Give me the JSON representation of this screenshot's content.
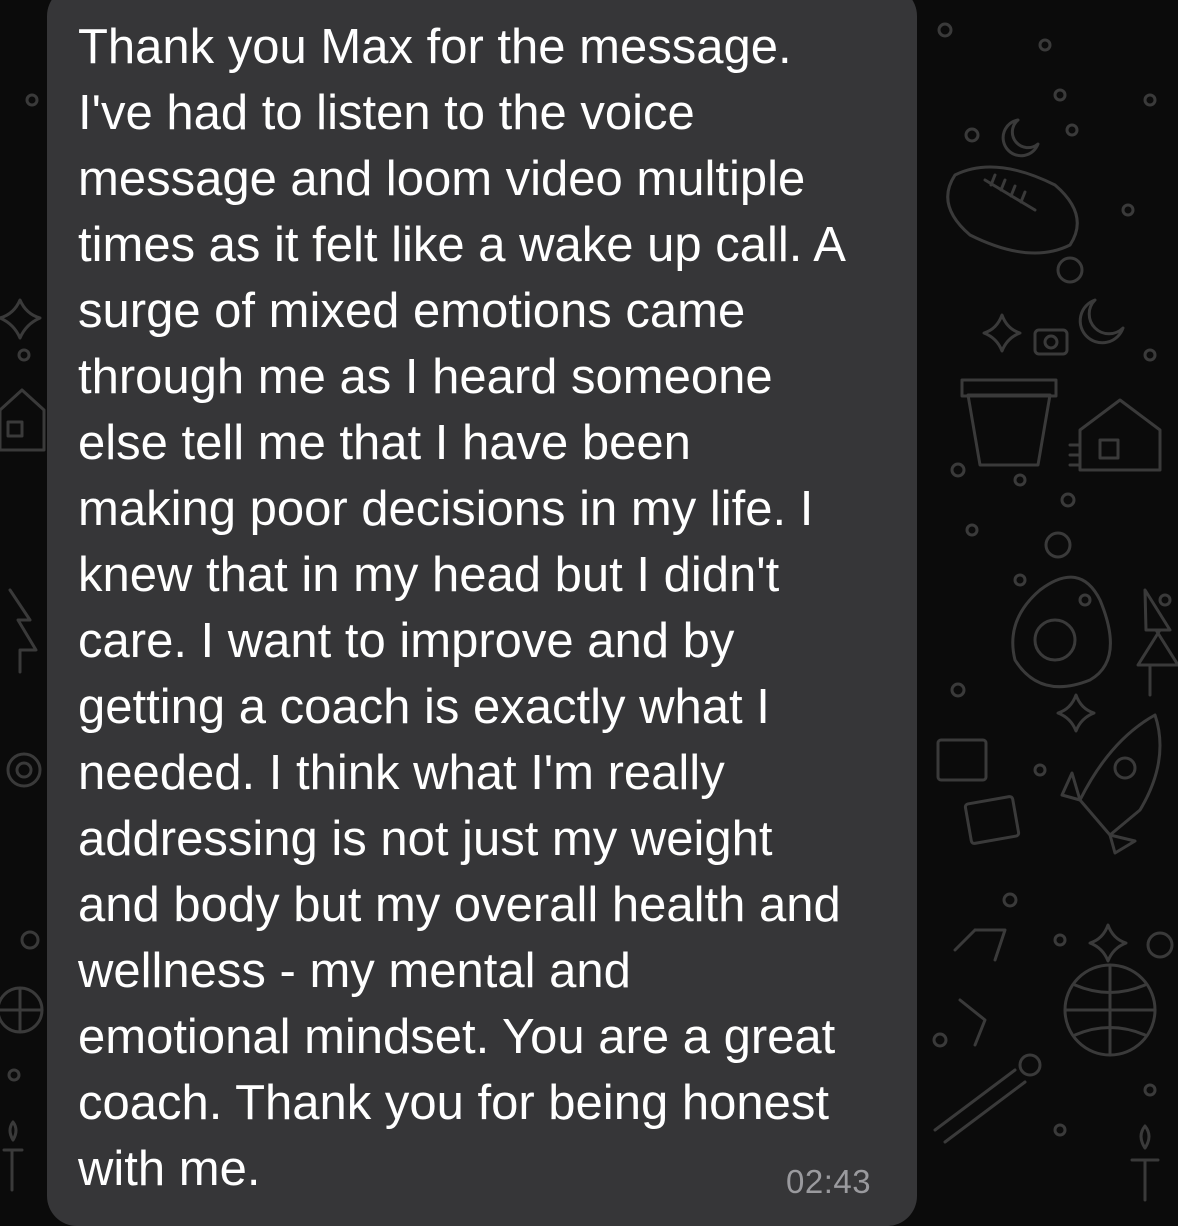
{
  "message": {
    "text": "Thank you Max for the message.\nI've had to listen to the voice\nmessage and loom video multiple\ntimes as it felt like a wake up call. A\nsurge of mixed emotions came\nthrough me as I heard someone\nelse tell me that I have been\nmaking poor decisions in my life. I\nknew that in my head but I didn't\ncare. I want to improve and by\ngetting a coach is exactly what I\nneeded. I think what I'm really\naddressing is not just my weight\nand body but my overall health and\nwellness - my mental and\nemotional mindset. You are a great\ncoach. Thank you for being honest\nwith me.",
    "time": "02:43"
  },
  "colors": {
    "background": "#0b0b0b",
    "bubble": "#363638",
    "text": "#ffffff",
    "timestamp": "#9a9a9e",
    "doodle": "#3a3a3a"
  },
  "background_icons": [
    "rocket-icon",
    "house-icon",
    "flower-pot-icon",
    "football-icon",
    "globe-icon",
    "avocado-icon",
    "sparkle-icon",
    "camera-icon",
    "tree-icon",
    "candle-icon",
    "moon-icon",
    "circle-icon"
  ]
}
